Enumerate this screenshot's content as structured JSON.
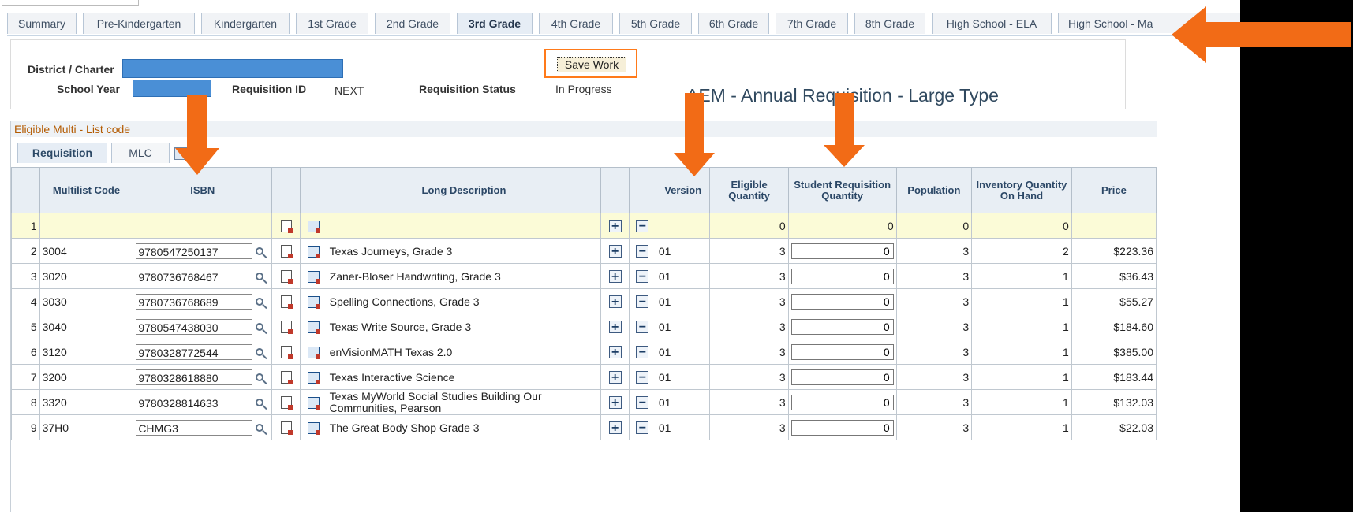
{
  "tabs": [
    "Summary",
    "Pre-Kindergarten",
    "Kindergarten",
    "1st Grade",
    "2nd Grade",
    "3rd Grade",
    "4th Grade",
    "5th Grade",
    "6th Grade",
    "7th Grade",
    "8th Grade",
    "High School - ELA",
    "High School - Ma"
  ],
  "active_tab": "3rd Grade",
  "header": {
    "district_label": "District / Charter",
    "school_year_label": "School Year",
    "requisition_id_label": "Requisition ID",
    "requisition_id_value": "NEXT",
    "requisition_status_label": "Requisition Status",
    "requisition_status_value": "In Progress",
    "save_label": "Save Work",
    "page_title": "AEM - Annual Requisition - Large Type"
  },
  "grid": {
    "title": "Eligible Multi - List code",
    "subtabs": [
      "Requisition",
      "MLC"
    ],
    "columns": {
      "multilist": "Multilist Code",
      "isbn": "ISBN",
      "long_desc": "Long Description",
      "version": "Version",
      "eligible": "Eligible Quantity",
      "student_req": "Student Requisition Quantity",
      "population": "Population",
      "inventory": "Inventory Quantity On Hand",
      "price": "Price"
    },
    "rows": [
      {
        "n": "1",
        "code": "",
        "isbn": "",
        "desc": "",
        "version": "",
        "eligible": "0",
        "student": "0",
        "population": "0",
        "inventory": "0",
        "price": ""
      },
      {
        "n": "2",
        "code": "3004",
        "isbn": "9780547250137",
        "desc": "Texas Journeys, Grade 3",
        "version": "01",
        "eligible": "3",
        "student": "0",
        "population": "3",
        "inventory": "2",
        "price": "$223.36"
      },
      {
        "n": "3",
        "code": "3020",
        "isbn": "9780736768467",
        "desc": "Zaner-Bloser Handwriting, Grade 3",
        "version": "01",
        "eligible": "3",
        "student": "0",
        "population": "3",
        "inventory": "1",
        "price": "$36.43"
      },
      {
        "n": "4",
        "code": "3030",
        "isbn": "9780736768689",
        "desc": "Spelling Connections, Grade 3",
        "version": "01",
        "eligible": "3",
        "student": "0",
        "population": "3",
        "inventory": "1",
        "price": "$55.27"
      },
      {
        "n": "5",
        "code": "3040",
        "isbn": "9780547438030",
        "desc": "Texas Write Source, Grade 3",
        "version": "01",
        "eligible": "3",
        "student": "0",
        "population": "3",
        "inventory": "1",
        "price": "$184.60"
      },
      {
        "n": "6",
        "code": "3120",
        "isbn": "9780328772544",
        "desc": "enVisionMATH Texas 2.0",
        "version": "01",
        "eligible": "3",
        "student": "0",
        "population": "3",
        "inventory": "1",
        "price": "$385.00"
      },
      {
        "n": "7",
        "code": "3200",
        "isbn": "9780328618880",
        "desc": "Texas Interactive Science",
        "version": "01",
        "eligible": "3",
        "student": "0",
        "population": "3",
        "inventory": "1",
        "price": "$183.44"
      },
      {
        "n": "8",
        "code": "3320",
        "isbn": "9780328814633",
        "desc": "Texas MyWorld Social Studies Building Our Communities, Pearson",
        "version": "01",
        "eligible": "3",
        "student": "0",
        "population": "3",
        "inventory": "1",
        "price": "$132.03"
      },
      {
        "n": "9",
        "code": "37H0",
        "isbn": "CHMG3",
        "desc": "The Great Body Shop Grade 3",
        "version": "01",
        "eligible": "3",
        "student": "0",
        "population": "3",
        "inventory": "1",
        "price": "$22.03"
      }
    ]
  },
  "colors": {
    "arrow": "#f26b16",
    "redact": "#4a8fd6",
    "row_highlight": "#fbfbd7",
    "title_orange": "#b35a00"
  },
  "icons": [
    "magnifier-icon",
    "report-icon",
    "detail-icon",
    "plus-icon",
    "minus-icon",
    "grid-settings-icon"
  ]
}
